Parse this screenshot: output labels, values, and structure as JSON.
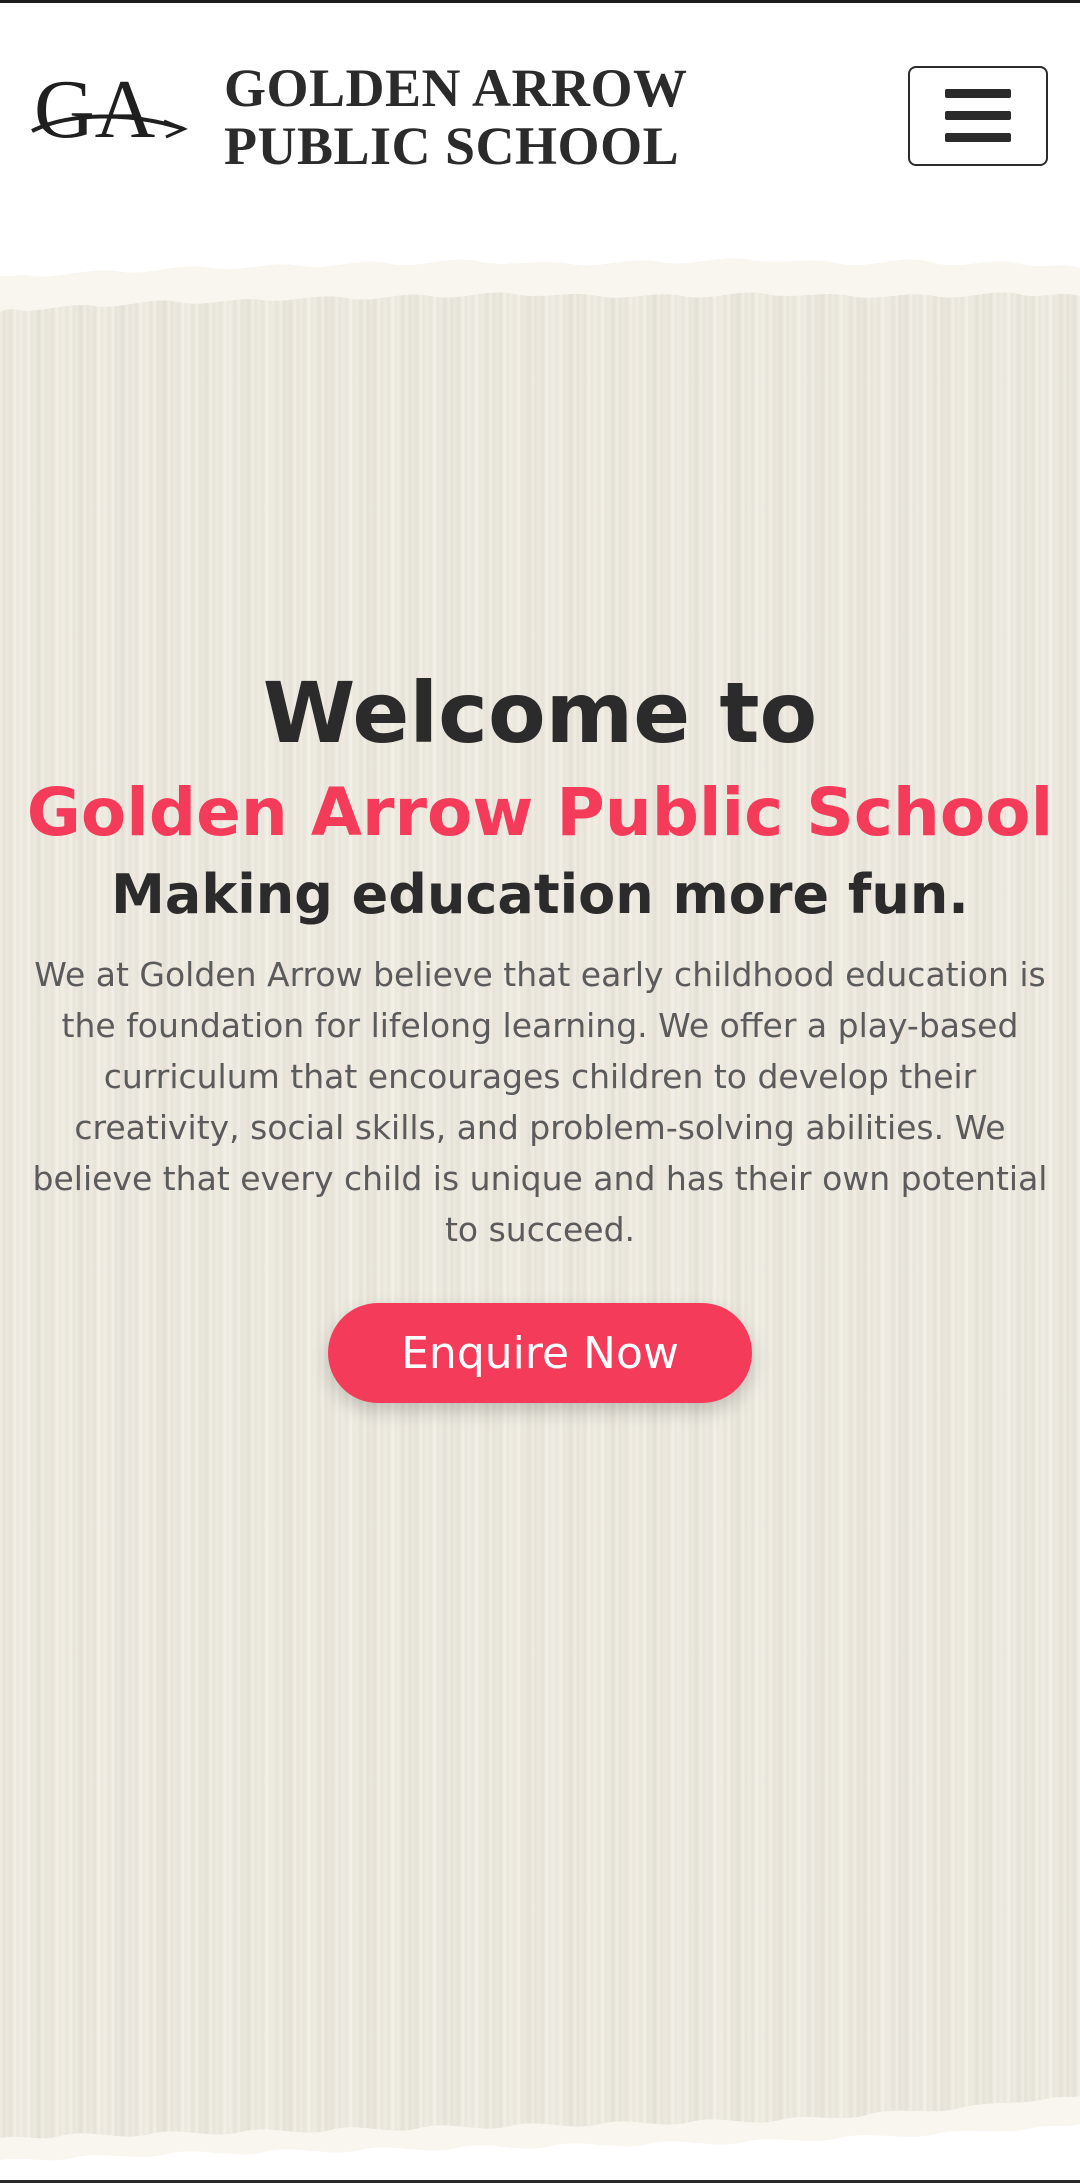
{
  "header": {
    "logo_text": "GA",
    "brand_line1": "GOLDEN ARROW",
    "brand_line2": "PUBLIC SCHOOL",
    "menu_icon": "hamburger-menu-icon"
  },
  "hero": {
    "heading": "Welcome to",
    "school_name": "Golden Arrow Public School",
    "tagline": "Making education more fun.",
    "description": "We at Golden Arrow believe that early childhood education is the foundation for lifelong learning. We offer a play-based curriculum that encourages children to develop their creativity, social skills, and problem-solving abilities. We believe that every child is unique and has their own potential to succeed.",
    "cta_label": "Enquire Now"
  },
  "colors": {
    "accent": "#f43b5a",
    "text_dark": "#2b2b2b",
    "text_body": "#5b5b5b",
    "paper": "#efebe0"
  }
}
